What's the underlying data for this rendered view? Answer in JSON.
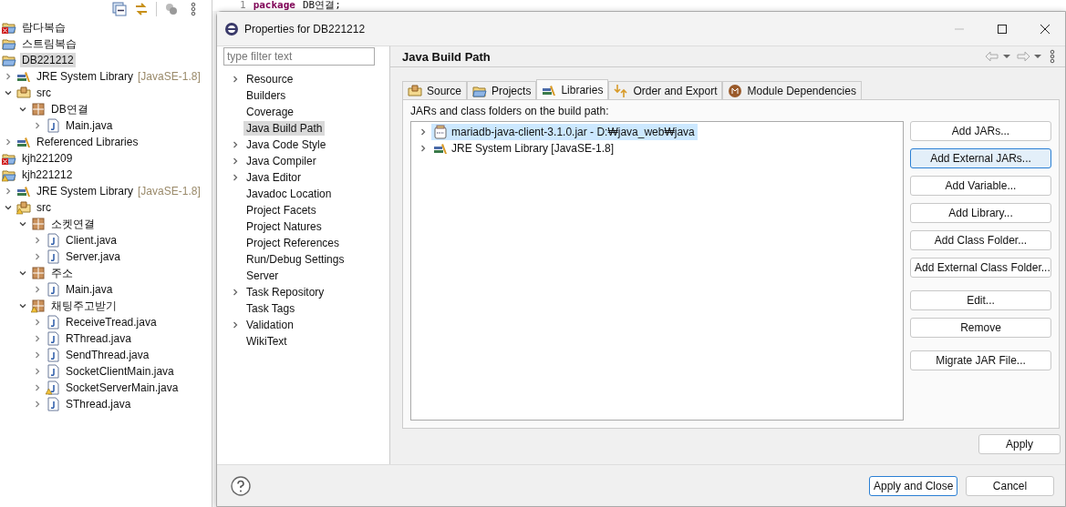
{
  "explorer": {
    "items": [
      {
        "label": "람다복습",
        "kind": "project",
        "error": true,
        "warning": false,
        "selected": false
      },
      {
        "label": "스트림복습",
        "kind": "project",
        "error": false,
        "warning": false,
        "selected": false
      },
      {
        "label": "DB221212",
        "kind": "project",
        "error": false,
        "warning": false,
        "selected": true,
        "children": [
          {
            "label": "JRE System Library",
            "note": "[JavaSE-1.8]",
            "kind": "library",
            "error": false,
            "warning": false,
            "expanded": false,
            "selected": false
          },
          {
            "label": "src",
            "kind": "source",
            "error": false,
            "warning": false,
            "expanded": true,
            "selected": false,
            "children": [
              {
                "label": "DB연결",
                "kind": "package",
                "error": false,
                "warning": false,
                "expanded": true,
                "selected": false,
                "children": [
                  {
                    "label": "Main.java",
                    "kind": "file",
                    "error": false,
                    "warning": false,
                    "expanded": false,
                    "selected": false
                  }
                ]
              }
            ]
          },
          {
            "label": "Referenced Libraries",
            "kind": "library",
            "error": false,
            "warning": false,
            "expanded": false,
            "selected": false
          }
        ]
      },
      {
        "label": "kjh221209",
        "kind": "project",
        "error": true,
        "warning": false,
        "selected": false
      },
      {
        "label": "kjh221212",
        "kind": "project",
        "error": false,
        "warning": true,
        "selected": false,
        "children": [
          {
            "label": "JRE System Library",
            "note": "[JavaSE-1.8]",
            "kind": "library",
            "error": false,
            "warning": false,
            "expanded": false,
            "selected": false
          },
          {
            "label": "src",
            "kind": "source",
            "error": false,
            "warning": true,
            "expanded": true,
            "selected": false,
            "children": [
              {
                "label": "소켓연결",
                "kind": "package",
                "error": false,
                "warning": false,
                "expanded": true,
                "selected": false,
                "children": [
                  {
                    "label": "Client.java",
                    "kind": "file",
                    "error": false,
                    "warning": false,
                    "expanded": false,
                    "selected": false
                  },
                  {
                    "label": "Server.java",
                    "kind": "file",
                    "error": false,
                    "warning": false,
                    "expanded": false,
                    "selected": false
                  }
                ]
              },
              {
                "label": "주소",
                "kind": "package",
                "error": false,
                "warning": false,
                "expanded": true,
                "selected": false,
                "children": [
                  {
                    "label": "Main.java",
                    "kind": "file",
                    "error": false,
                    "warning": false,
                    "expanded": false,
                    "selected": false
                  }
                ]
              },
              {
                "label": "채팅주고받기",
                "kind": "package",
                "error": false,
                "warning": true,
                "expanded": true,
                "selected": false,
                "children": [
                  {
                    "label": "ReceiveTread.java",
                    "kind": "file",
                    "error": false,
                    "warning": false,
                    "expanded": false,
                    "selected": false
                  },
                  {
                    "label": "RThread.java",
                    "kind": "file",
                    "error": false,
                    "warning": false,
                    "expanded": false,
                    "selected": false
                  },
                  {
                    "label": "SendThread.java",
                    "kind": "file",
                    "error": false,
                    "warning": false,
                    "expanded": false,
                    "selected": false
                  },
                  {
                    "label": "SocketClientMain.java",
                    "kind": "file",
                    "error": false,
                    "warning": false,
                    "expanded": false,
                    "selected": false
                  },
                  {
                    "label": "SocketServerMain.java",
                    "kind": "file",
                    "error": false,
                    "warning": true,
                    "expanded": false,
                    "selected": false
                  },
                  {
                    "label": "SThread.java",
                    "kind": "file",
                    "error": false,
                    "warning": false,
                    "expanded": false,
                    "selected": false
                  }
                ]
              }
            ]
          }
        ]
      }
    ]
  },
  "editor": {
    "line_number": "1",
    "keyword": "package",
    "code": "DB연결;"
  },
  "dialog": {
    "title": "Properties for DB221212",
    "filter": {
      "placeholder": "type filter text"
    },
    "pages": [
      {
        "label": "Resource",
        "kind": "group",
        "selected": false
      },
      {
        "label": "Builders",
        "kind": "leaf",
        "selected": false
      },
      {
        "label": "Coverage",
        "kind": "leaf",
        "selected": false
      },
      {
        "label": "Java Build Path",
        "kind": "leaf",
        "selected": true
      },
      {
        "label": "Java Code Style",
        "kind": "group",
        "selected": false
      },
      {
        "label": "Java Compiler",
        "kind": "group",
        "selected": false
      },
      {
        "label": "Java Editor",
        "kind": "group",
        "selected": false
      },
      {
        "label": "Javadoc Location",
        "kind": "leaf",
        "selected": false
      },
      {
        "label": "Project Facets",
        "kind": "leaf",
        "selected": false
      },
      {
        "label": "Project Natures",
        "kind": "leaf",
        "selected": false
      },
      {
        "label": "Project References",
        "kind": "leaf",
        "selected": false
      },
      {
        "label": "Run/Debug Settings",
        "kind": "leaf",
        "selected": false
      },
      {
        "label": "Server",
        "kind": "leaf",
        "selected": false
      },
      {
        "label": "Task Repository",
        "kind": "group",
        "selected": false
      },
      {
        "label": "Task Tags",
        "kind": "leaf",
        "selected": false
      },
      {
        "label": "Validation",
        "kind": "group",
        "selected": false
      },
      {
        "label": "WikiText",
        "kind": "leaf",
        "selected": false
      }
    ],
    "heading": "Java Build Path",
    "tabs": [
      {
        "label": "Source",
        "kind": "source",
        "selected": false
      },
      {
        "label": "Projects",
        "kind": "projects",
        "selected": false
      },
      {
        "label": "Libraries",
        "kind": "libraries",
        "selected": true
      },
      {
        "label": "Order and Export",
        "kind": "order",
        "selected": false
      },
      {
        "label": "Module Dependencies",
        "kind": "module",
        "selected": false
      }
    ],
    "list_label": "JARs and class folders on the build path:",
    "entries": [
      {
        "label": "mariadb-java-client-3.1.0.jar - D:₩java_web₩java",
        "kind": "jar",
        "selected": true
      },
      {
        "label": "JRE System Library [JavaSE-1.8]",
        "kind": "library",
        "selected": false
      }
    ],
    "button_groups": [
      [
        {
          "label": "Add JARs...",
          "focused": false
        },
        {
          "label": "Add External JARs...",
          "focused": true
        },
        {
          "label": "Add Variable...",
          "focused": false
        },
        {
          "label": "Add Library...",
          "focused": false
        },
        {
          "label": "Add Class Folder...",
          "focused": false
        },
        {
          "label": "Add External Class Folder...",
          "focused": false
        }
      ],
      [
        {
          "label": "Edit...",
          "focused": false
        },
        {
          "label": "Remove",
          "focused": false
        }
      ],
      [
        {
          "label": "Migrate JAR File...",
          "focused": false
        }
      ]
    ],
    "apply": "Apply",
    "footer_buttons": [
      {
        "label": "Apply and Close",
        "default": true
      },
      {
        "label": "Cancel",
        "default": false
      }
    ]
  }
}
